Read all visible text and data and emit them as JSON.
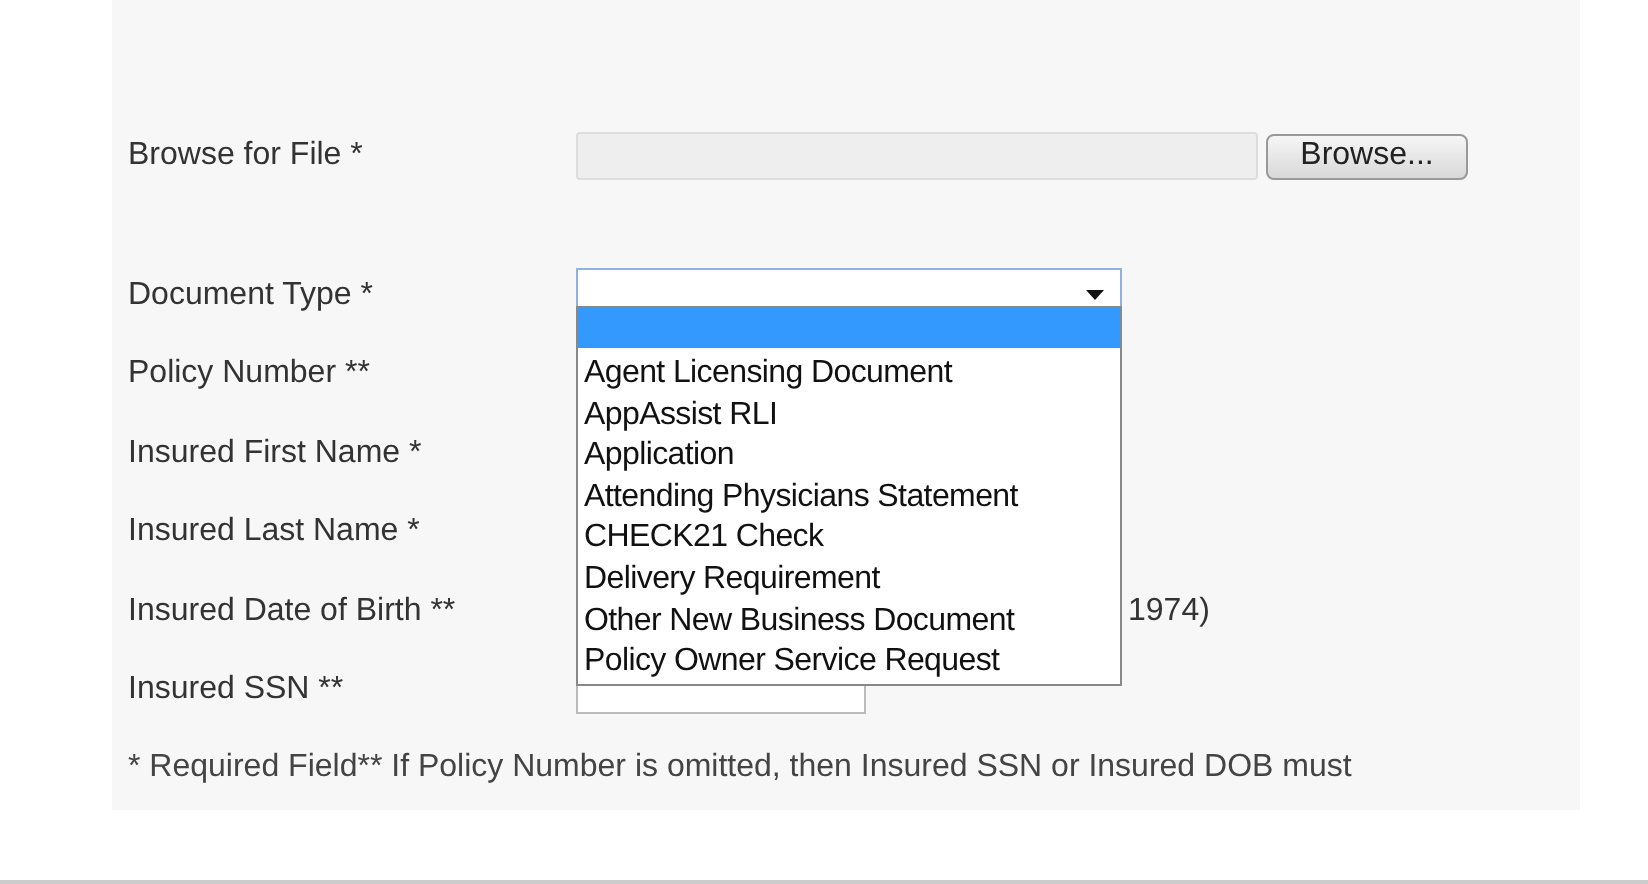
{
  "form": {
    "fields": [
      {
        "label": "Browse for File *",
        "kind": "file",
        "button": "Browse..."
      },
      {
        "label": "Document Type *",
        "kind": "select"
      },
      {
        "label": "Policy Number **",
        "kind": "text"
      },
      {
        "label": "Insured First Name *",
        "kind": "text"
      },
      {
        "label": "Insured Last Name *",
        "kind": "text"
      },
      {
        "label": "Insured Date of Birth **",
        "kind": "text",
        "hint": "1974)"
      },
      {
        "label": "Insured SSN **",
        "kind": "text"
      }
    ],
    "footnote": "* Required Field** If Policy Number is omitted, then Insured SSN or Insured DOB must"
  },
  "dropdown": {
    "options": [
      {
        "selected": true
      },
      {
        "label": "Agent Licensing Document",
        "selected": false
      },
      {
        "label": "AppAssist RLI",
        "selected": false
      },
      {
        "label": "Application",
        "selected": false
      },
      {
        "label": "Attending Physicians Statement",
        "selected": false
      },
      {
        "label": "CHECK21 Check",
        "selected": false
      },
      {
        "label": "Delivery Requirement",
        "selected": false
      },
      {
        "label": "Other New Business Document",
        "selected": false
      },
      {
        "label": "Policy Owner Service Request",
        "selected": false
      }
    ]
  }
}
